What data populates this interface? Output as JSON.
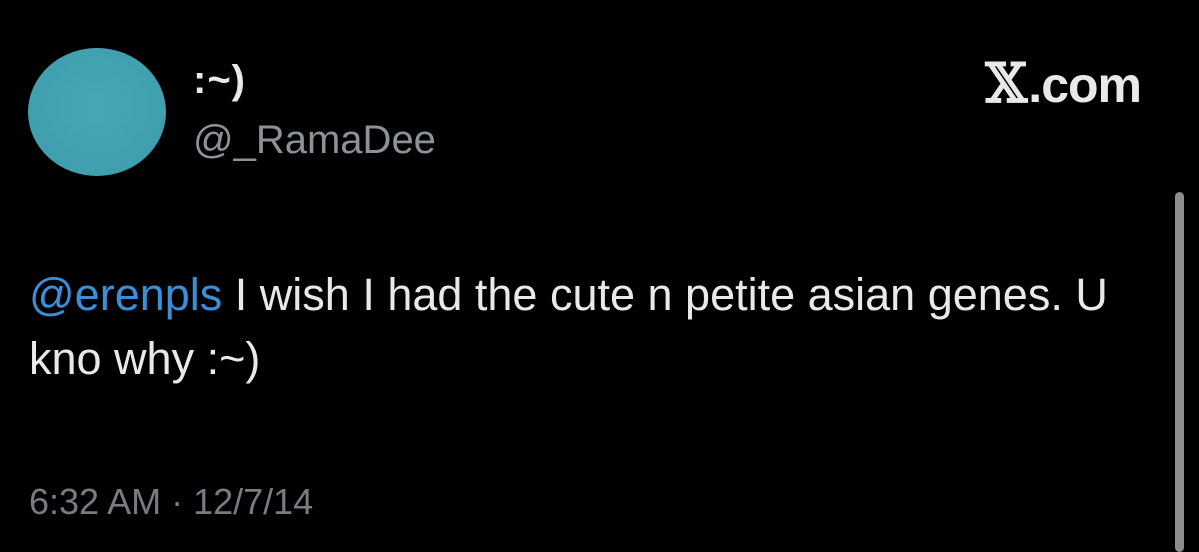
{
  "author": {
    "display_name": ":~)",
    "handle": "@_RamaDee",
    "avatar_color": "#43a2b1"
  },
  "brand": {
    "icon": "x-logo-icon",
    "glyph": "𝕏",
    "label": ".com"
  },
  "tweet": {
    "mention": "@erenpls",
    "body": " I wish I had the cute n petite asian genes. U kno why :~)",
    "mention_color": "#3b8fd9"
  },
  "meta": {
    "timestamp": "6:32 AM · 12/7/14"
  },
  "colors": {
    "background": "#000000",
    "primary_text": "#e7e9ea",
    "secondary_text": "#8b9298"
  }
}
